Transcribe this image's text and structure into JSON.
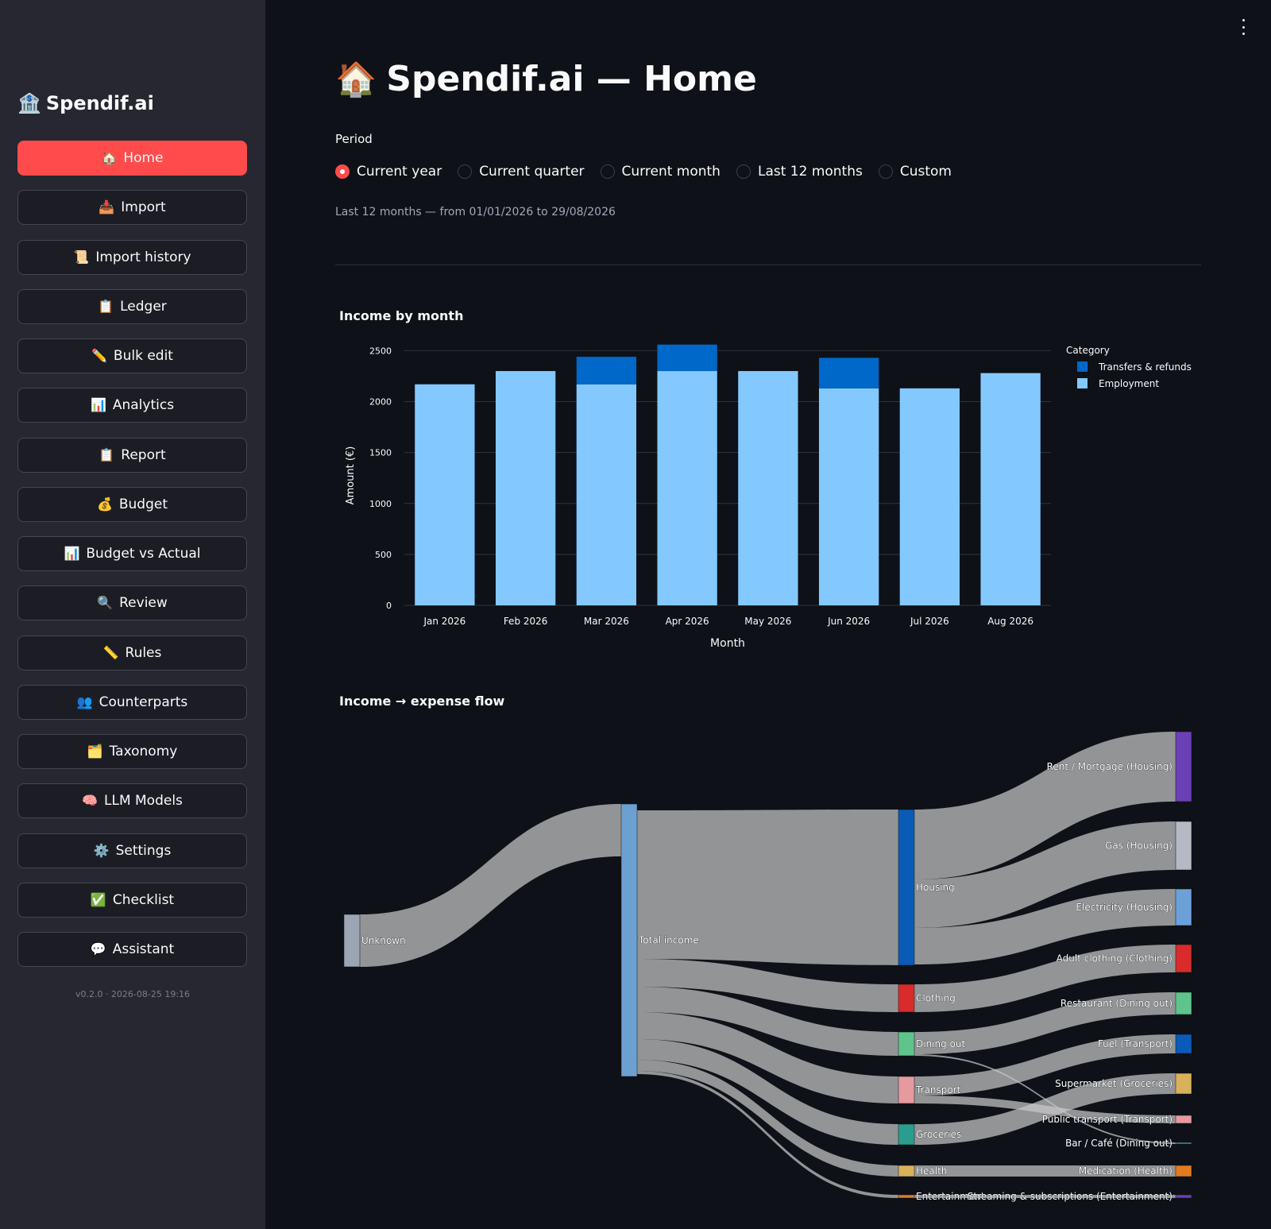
{
  "sidebar": {
    "brand": {
      "icon": "🏦",
      "title": "Spendif.ai"
    },
    "items": [
      {
        "icon": "🏠",
        "label": "Home",
        "active": true
      },
      {
        "icon": "📥",
        "label": "Import"
      },
      {
        "icon": "📜",
        "label": "Import history"
      },
      {
        "icon": "📋",
        "label": "Ledger"
      },
      {
        "icon": "✏️",
        "label": "Bulk edit"
      },
      {
        "icon": "📊",
        "label": "Analytics"
      },
      {
        "icon": "📋",
        "label": "Report"
      },
      {
        "icon": "💰",
        "label": "Budget"
      },
      {
        "icon": "📊",
        "label": "Budget vs Actual"
      },
      {
        "icon": "🔍",
        "label": "Review"
      },
      {
        "icon": "📏",
        "label": "Rules"
      },
      {
        "icon": "👥",
        "label": "Counterparts"
      },
      {
        "icon": "🗂️",
        "label": "Taxonomy"
      },
      {
        "icon": "🧠",
        "label": "LLM Models"
      },
      {
        "icon": "⚙️",
        "label": "Settings"
      },
      {
        "icon": "✅",
        "label": "Checklist"
      },
      {
        "icon": "💬",
        "label": "Assistant"
      }
    ],
    "version": "v0.2.0 · 2026-08-25 19:16"
  },
  "header": {
    "icon": "🏠",
    "title": "Spendif.ai — Home"
  },
  "period": {
    "label": "Period",
    "options": [
      "Current year",
      "Current quarter",
      "Current month",
      "Last 12 months",
      "Custom"
    ],
    "selected": "Current year",
    "caption": "Last 12 months — from 01/01/2026 to 29/08/2026"
  },
  "income_chart_title": "Income by month",
  "flow_chart_title": "Income → expense flow",
  "chart_data": [
    {
      "type": "bar",
      "stacked": true,
      "categories": [
        "Jan 2026",
        "Feb 2026",
        "Mar 2026",
        "Apr 2026",
        "May 2026",
        "Jun 2026",
        "Jul 2026",
        "Aug 2026"
      ],
      "series": [
        {
          "name": "Employment",
          "color": "#83c9ff",
          "values": [
            2170,
            2300,
            2170,
            2300,
            2300,
            2130,
            2130,
            2280
          ]
        },
        {
          "name": "Transfers & refunds",
          "color": "#0068c9",
          "values": [
            0,
            0,
            270,
            260,
            0,
            300,
            0,
            0
          ]
        }
      ],
      "legend_title": "Category",
      "legend_order": [
        "Transfers & refunds",
        "Employment"
      ],
      "xlabel": "Month",
      "ylabel": "Amount (€)",
      "yticks": [
        0,
        500,
        1000,
        1500,
        2000,
        2500
      ],
      "ylim": [
        0,
        2550
      ],
      "legend_position": "right",
      "grid": true
    },
    {
      "type": "sankey",
      "nodes": [
        {
          "name": "Unknown",
          "color": "#9ba5b4"
        },
        {
          "name": "Total income",
          "color": "#6ca0d0"
        },
        {
          "name": "Housing",
          "color": "#0a5bb8"
        },
        {
          "name": "Clothing",
          "color": "#d92b2b"
        },
        {
          "name": "Dining out",
          "color": "#5ec48b"
        },
        {
          "name": "Transport",
          "color": "#e59aa0"
        },
        {
          "name": "Groceries",
          "color": "#2a9d8f"
        },
        {
          "name": "Health",
          "color": "#d9b15a"
        },
        {
          "name": "Entertainment",
          "color": "#e07b1f"
        },
        {
          "name": "Rent / Mortgage (Housing)",
          "color": "#6b3fb5"
        },
        {
          "name": "Gas (Housing)",
          "color": "#b4b9c4"
        },
        {
          "name": "Electricity (Housing)",
          "color": "#6ca0d8"
        },
        {
          "name": "Adult clothing (Clothing)",
          "color": "#d92b2b"
        },
        {
          "name": "Restaurant (Dining out)",
          "color": "#5ec48b"
        },
        {
          "name": "Fuel (Transport)",
          "color": "#0a5bb8"
        },
        {
          "name": "Supermarket (Groceries)",
          "color": "#d9b15a"
        },
        {
          "name": "Public transport (Transport)",
          "color": "#e59aa0"
        },
        {
          "name": "Bar / Café (Dining out)",
          "color": "#2a9d8f"
        },
        {
          "name": "Medication (Health)",
          "color": "#e07b1f"
        },
        {
          "name": "Streaming & subscriptions (Entertainment)",
          "color": "#6b3fb5"
        }
      ]
    }
  ]
}
